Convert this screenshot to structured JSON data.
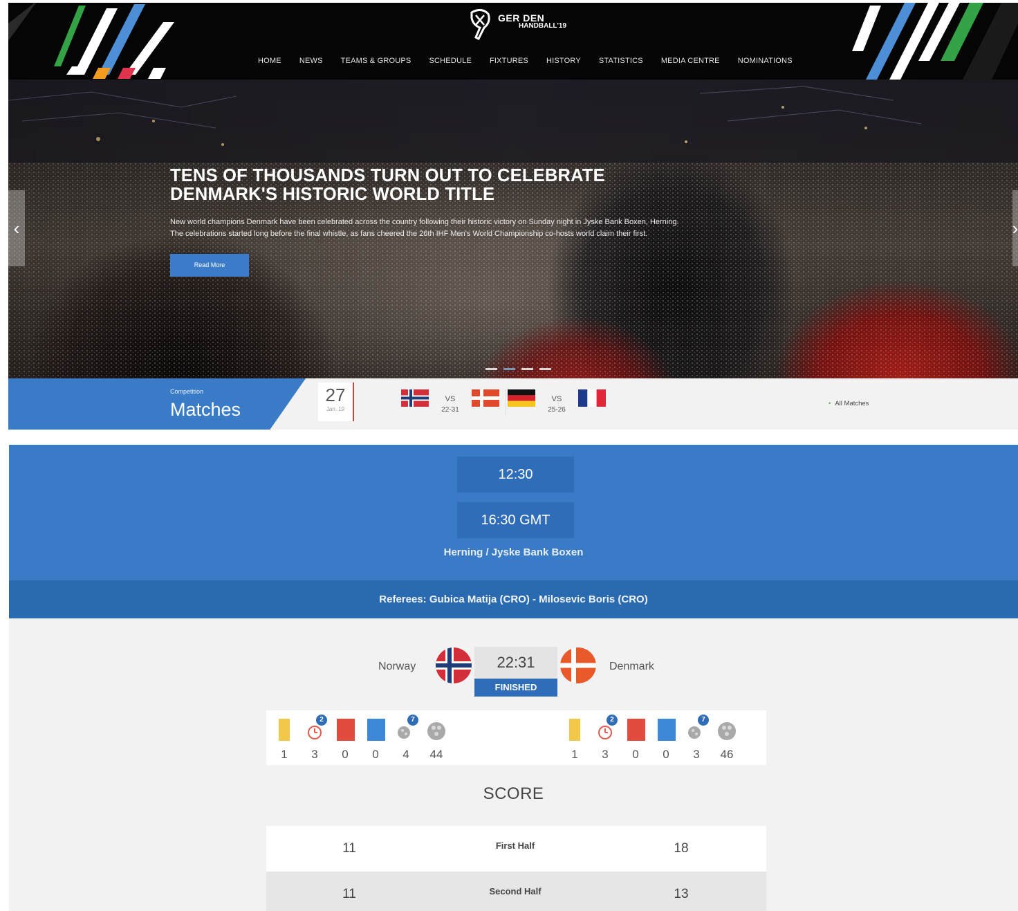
{
  "header": {
    "logo_line1": "GER DEN",
    "logo_line2": "HANDBALL'19",
    "nav": [
      "HOME",
      "NEWS",
      "TEAMS & GROUPS",
      "SCHEDULE",
      "FIXTURES",
      "HISTORY",
      "STATISTICS",
      "MEDIA CENTRE",
      "NOMINATIONS"
    ]
  },
  "hero": {
    "title_line1": "TENS OF THOUSANDS TURN OUT TO CELEBRATE",
    "title_line2": "DENMARK'S HISTORIC WORLD TITLE",
    "text": "New world champions Denmark have been celebrated across the country following their historic victory on Sunday night in Jyske Bank Boxen, Herning. The celebrations started long before the final whistle, as fans cheered the 26th IHF Men's World Championship co-hosts world claim their first.",
    "button_label": "Read More",
    "prev_arrow": "‹",
    "next_arrow": "›",
    "slide_count": 4,
    "active_slide": 2
  },
  "matches_bar": {
    "small_label": "Competition",
    "big_label": "Matches",
    "date_day": "27",
    "date_month": "Jan. 19",
    "fixtures": [
      {
        "home": "Norway",
        "away": "Denmark",
        "vs": "VS",
        "score": "22-31"
      },
      {
        "home": "Germany",
        "away": "France",
        "vs": "VS",
        "score": "25-26"
      }
    ],
    "all_matches_label": "All Matches",
    "all_matches_bullet": "•"
  },
  "match": {
    "time_local": "12:30",
    "time_gmt": "16:30 GMT",
    "venue": "Herning / Jyske Bank Boxen",
    "referees": "Referees: Gubica Matija (CRO) - Milosevic Boris (CRO)",
    "home_team": "Norway",
    "away_team": "Denmark",
    "score": "22:31",
    "status": "FINISHED",
    "home_stats": [
      {
        "icon": "yellow-card-icon",
        "value": "1"
      },
      {
        "icon": "two-minute-suspension-icon",
        "value": "3",
        "badge": "2"
      },
      {
        "icon": "red-card-icon",
        "value": "0"
      },
      {
        "icon": "blue-card-icon",
        "value": "0"
      },
      {
        "icon": "seven-meter-goal-icon",
        "value": "4",
        "badge": "7"
      },
      {
        "icon": "shots-ball-icon",
        "value": "44"
      }
    ],
    "away_stats": [
      {
        "icon": "yellow-card-icon",
        "value": "1"
      },
      {
        "icon": "two-minute-suspension-icon",
        "value": "3",
        "badge": "2"
      },
      {
        "icon": "red-card-icon",
        "value": "0"
      },
      {
        "icon": "blue-card-icon",
        "value": "0"
      },
      {
        "icon": "seven-meter-goal-icon",
        "value": "3",
        "badge": "7"
      },
      {
        "icon": "shots-ball-icon",
        "value": "46"
      }
    ],
    "score_heading": "SCORE",
    "halves": [
      {
        "label": "First Half",
        "home": "11",
        "away": "18"
      },
      {
        "label": "Second Half",
        "home": "11",
        "away": "13"
      }
    ]
  },
  "colors": {
    "brand_blue": "#3a7bc7",
    "dark_blue": "#2f6db8",
    "accent_red": "#e23a32"
  }
}
